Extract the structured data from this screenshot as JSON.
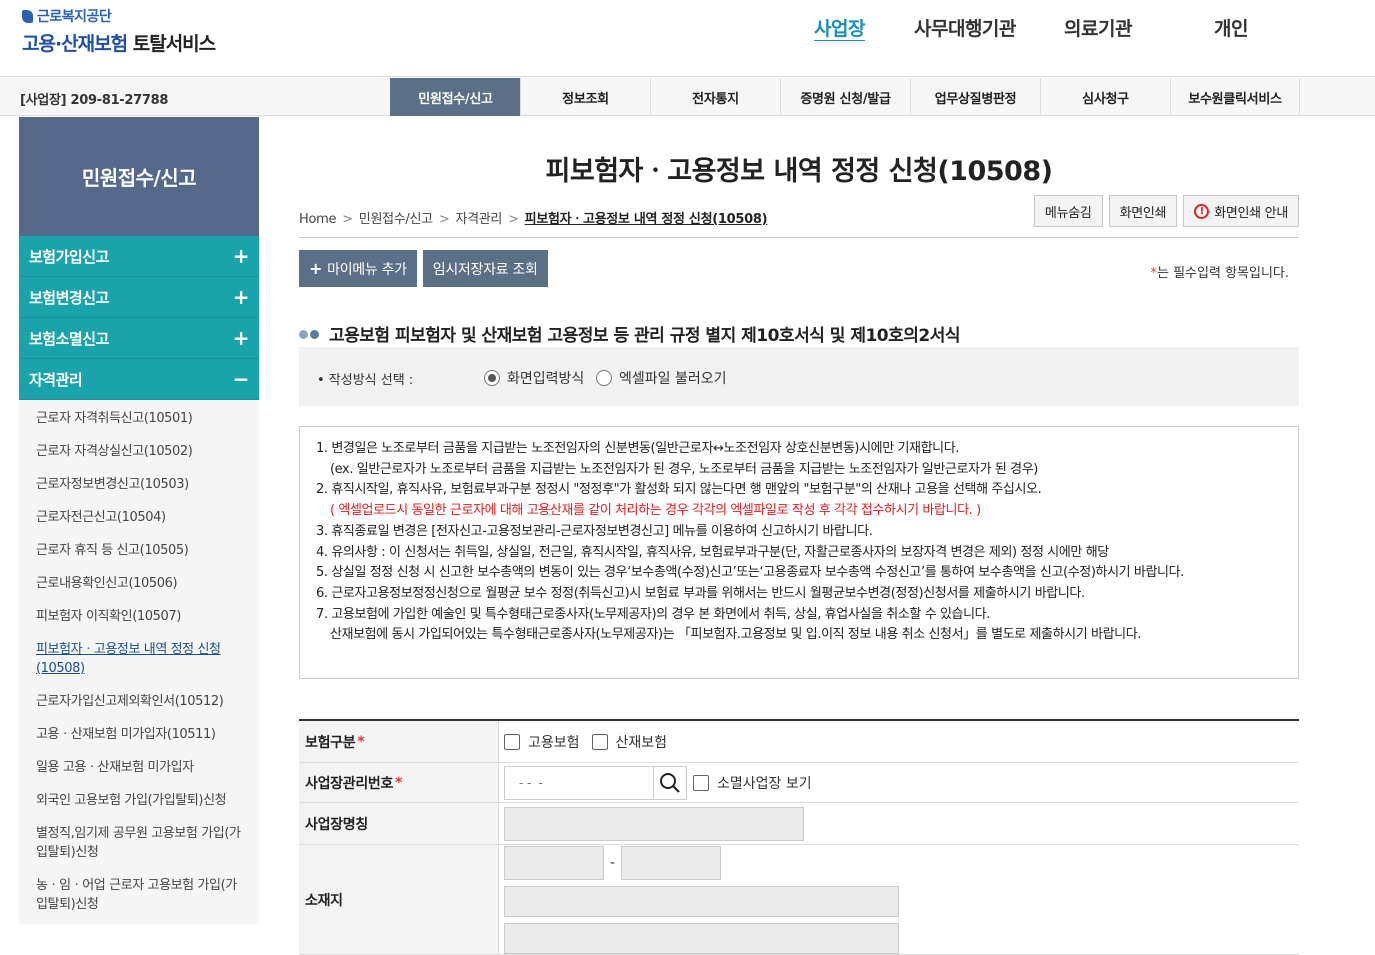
{
  "header": {
    "org": "근로복지공단",
    "service_prefix": "고용·산재보험",
    "service_suffix": "토탈서비스",
    "gnb": [
      {
        "label": "사업장"
      },
      {
        "label": "사무대행기관"
      },
      {
        "label": "의료기관"
      },
      {
        "label": "개인"
      }
    ],
    "active_gnb": "사업장"
  },
  "subbar": {
    "bizno": "[사업장] 209-81-27788",
    "tabs": [
      {
        "label": "민원접수/신고"
      },
      {
        "label": "정보조회"
      },
      {
        "label": "전자통지"
      },
      {
        "label": "증명원 신청/발급"
      },
      {
        "label": "업무상질병판정"
      },
      {
        "label": "심사청구"
      },
      {
        "label": "보수원클릭서비스"
      }
    ],
    "active_tab": "민원접수/신고"
  },
  "sidebar": {
    "title": "민원접수/신고",
    "groups": [
      {
        "label": "보험가입신고",
        "sign": "+"
      },
      {
        "label": "보험변경신고",
        "sign": "+"
      },
      {
        "label": "보험소멸신고",
        "sign": "+"
      },
      {
        "label": "자격관리",
        "sign": "−"
      }
    ],
    "items": [
      {
        "label": "근로자 자격취득신고(10501)"
      },
      {
        "label": "근로자 자격상실신고(10502)"
      },
      {
        "label": "근로자정보변경신고(10503)"
      },
      {
        "label": "근로자전근신고(10504)"
      },
      {
        "label": "근로자 휴직 등 신고(10505)"
      },
      {
        "label": "근로내용확인신고(10506)"
      },
      {
        "label": "피보험자 이직확인(10507)"
      },
      {
        "label": "피보험자ㆍ고용정보 내역 정정 신청(10508)"
      },
      {
        "label": "근로자가입신고제외확인서(10512)"
      },
      {
        "label": "고용ㆍ산재보험 미가입자(10511)"
      },
      {
        "label": "일용 고용ㆍ산재보험 미가입자"
      },
      {
        "label": "외국인 고용보험 가입(가입탈퇴)신청"
      },
      {
        "label": "별정직,임기제 공무원 고용보험 가입(가입탈퇴)신청"
      },
      {
        "label": "농ㆍ임ㆍ어업 근로자 고용보험 가입(가입탈퇴)신청"
      }
    ],
    "active_item": 7
  },
  "main": {
    "title": "피보험자ㆍ고용정보 내역 정정 신청(10508)",
    "breadcrumb": [
      "Home",
      "민원접수/신고",
      "자격관리",
      "피보험자ㆍ고용정보 내역 정정 신청(10508)"
    ],
    "toolbar": {
      "hide_menu": "메뉴숨김",
      "print": "화면인쇄",
      "print_guide": "화면인쇄 안내",
      "print_guide_icon": "!"
    },
    "actions": {
      "add_mymenu": "마이메뉴 추가",
      "add_mymenu_icon": "+",
      "temp_load": "임시저장자료 조회"
    },
    "required_note_star": "*",
    "required_note": "는 필수입력 항목입니다.",
    "section_title": "고용보험 피보험자 및 산재보험 고용정보 등 관리 규정 별지 제10호서식 및 제10호의2서식",
    "mode": {
      "label": "• 작성방식 선택 :",
      "options": [
        {
          "label": "화면입력방식",
          "selected": true
        },
        {
          "label": "엑셀파일 불러오기",
          "selected": false
        }
      ]
    },
    "notes": {
      "n1": "1. 변경일은 노조로부터 금품을 지급받는 노조전임자의 신분변동(일반근로자↔노조전임자 상호신분변동)시에만 기재합니다.",
      "n1b": "(ex. 일반근로자가 노조로부터 금품을 지급받는 노조전임자가 된 경우, 노조로부터 금품을 지급받는 노조전임자가 일반근로자가 된 경우)",
      "n2": "2. 휴직시작일, 휴직사유, 보험료부과구분 정정시 \"정정후\"가 활성화 되지 않는다면 행 맨앞의 \"보험구분\"의 산재나 고용을 선택해 주십시오.",
      "n2b": "( 엑셀업로드시 동일한 근로자에 대해 고용산재를 같이 처리하는 경우 각각의 엑셀파일로 작성 후 각각 접수하시기 바랍니다. )",
      "n3": "3. 휴직종료일 변경은 [전자신고-고용정보관리-근로자정보변경신고] 메뉴를 이용하여 신고하시기 바랍니다.",
      "n4": "4. 유의사항 : 이 신청서는 취득일, 상실일, 전근일, 휴직시작일, 휴직사유, 보험료부과구분(단, 자활근로종사자의 보장자격 변경은 제외) 정정 시에만 해당",
      "n5": "5. 상실일 정정 신청 시 신고한 보수총액의 변동이 있는 경우‘보수총액(수정)신고’또는‘고용종료자 보수총액 수정신고’를 통하여 보수총액을 신고(수정)하시기 바랍니다.",
      "n6": "6. 근로자고용정보정정신청으로 월평균 보수 정정(취득신고)시 보험료 부과를 위해서는 반드시 월평균보수변경(정정)신청서를 제출하시기 바랍니다.",
      "n7": "7. 고용보험에 가입한 예술인 및 특수형태근로종사자(노무제공자)의 경우 본 화면에서 취득, 상실, 휴업사실을 취소할 수 있습니다.",
      "n7b": "산재보험에 동시 가입되어있는 특수형태근로종사자(노무제공자)는 「피보험자.고용정보 및 입.이직 정보 내용 취소 신청서」를 별도로 제출하시기 바랍니다."
    },
    "form": {
      "insurance_type_label": "보험구분",
      "insurance_options": [
        "고용보험",
        "산재보험"
      ],
      "biz_no_label": "사업장관리번호",
      "biz_no_placeholder": "- -  -",
      "closed_biz_label": "소멸사업장 보기",
      "biz_name_label": "사업장명칭",
      "address_label": "소재지",
      "address_sep": "-",
      "required_star": "*"
    }
  }
}
